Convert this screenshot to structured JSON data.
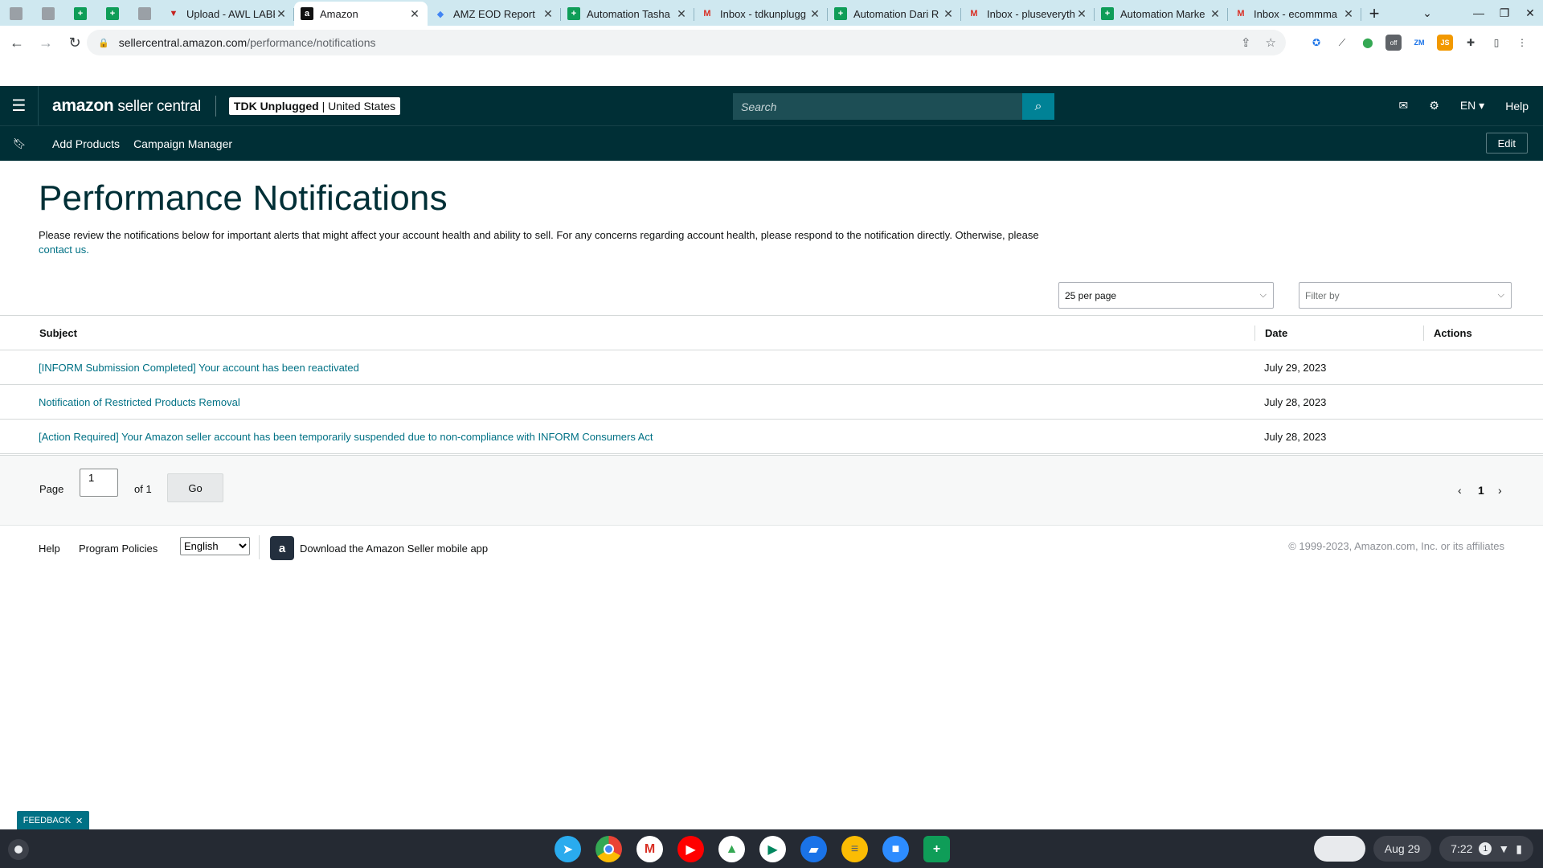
{
  "browser": {
    "pinned_tabs": [
      {
        "icon": "tab-favicon"
      },
      {
        "icon": "tab-favicon"
      },
      {
        "icon": "google-sheets-icon"
      },
      {
        "icon": "google-sheets-icon"
      },
      {
        "icon": "google-sheets-icon"
      }
    ],
    "tabs": [
      {
        "title": "Upload - AWL LABE",
        "icon": "awl-icon"
      },
      {
        "title": "Amazon",
        "icon": "amazon-icon",
        "active": true
      },
      {
        "title": "AMZ EOD Report",
        "icon": "amz-icon"
      },
      {
        "title": "Automation Tasha",
        "icon": "google-sheets-icon"
      },
      {
        "title": "Inbox - tdkunplugg",
        "icon": "gmail-icon"
      },
      {
        "title": "Automation Dari R",
        "icon": "google-sheets-icon"
      },
      {
        "title": "Inbox - pluseveryth",
        "icon": "gmail-icon"
      },
      {
        "title": "Automation Marke",
        "icon": "google-sheets-icon"
      },
      {
        "title": "Inbox - ecommma",
        "icon": "gmail-icon"
      }
    ],
    "url_host": "sellercentral.amazon.com",
    "url_path": "/performance/notifications"
  },
  "header": {
    "logo_brand": "amazon",
    "logo_suffix": "seller central",
    "account_name": "TDK Unplugged",
    "account_region": "| United States",
    "search_placeholder": "Search",
    "language": "EN",
    "help": "Help"
  },
  "subnav": {
    "links": [
      "Add Products",
      "Campaign Manager"
    ],
    "edit": "Edit"
  },
  "page": {
    "title": "Performance Notifications",
    "intro_text": "Please review the notifications below for important alerts that might affect your account health and ability to sell. For any concerns regarding account health, please respond to the notification directly. Otherwise, please ",
    "intro_link": "contact us.",
    "per_page": "25 per page",
    "filter_placeholder": "Filter by"
  },
  "table": {
    "columns": [
      "Subject",
      "Date",
      "Actions"
    ],
    "rows": [
      {
        "subject": "[INFORM Submission Completed] Your account has been reactivated",
        "date": "July 29, 2023"
      },
      {
        "subject": "Notification of Restricted Products Removal",
        "date": "July 28, 2023"
      },
      {
        "subject": "[Action Required] Your Amazon seller account has been temporarily suspended due to non-compliance with INFORM Consumers Act",
        "date": "July 28, 2023"
      }
    ]
  },
  "pagination": {
    "page_label": "Page",
    "page_value": "1",
    "of_label": "of 1",
    "go": "Go",
    "current": "1"
  },
  "footer": {
    "help": "Help",
    "policies": "Program Policies",
    "language": "English",
    "app_text": "Download the Amazon Seller mobile app",
    "copyright": "© 1999-2023, Amazon.com, Inc. or its affiliates"
  },
  "feedback": "FEEDBACK",
  "shelf": {
    "date": "Aug 29",
    "time": "7:22",
    "apps": [
      {
        "icon": "telegram-icon",
        "color": "#2aabee"
      },
      {
        "icon": "chrome-icon",
        "color": "#ea4335"
      },
      {
        "icon": "gmail-icon",
        "color": "#ffffff"
      },
      {
        "icon": "youtube-icon",
        "color": "#ff0000"
      },
      {
        "icon": "google-drive-icon",
        "color": "#34a853"
      },
      {
        "icon": "play-store-icon",
        "color": "#01875f"
      },
      {
        "icon": "files-icon",
        "color": "#1a73e8"
      },
      {
        "icon": "keep-icon",
        "color": "#fbbc04"
      },
      {
        "icon": "zoom-icon",
        "color": "#2d8cff"
      },
      {
        "icon": "google-sheets-icon",
        "color": "#0f9d58"
      }
    ]
  }
}
